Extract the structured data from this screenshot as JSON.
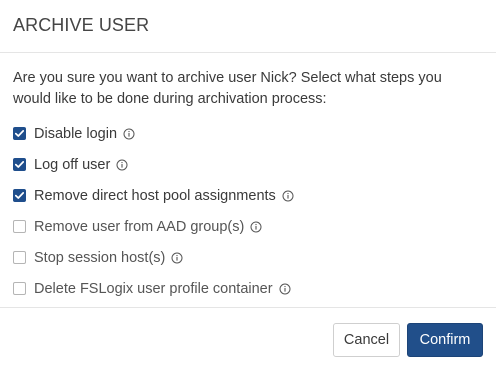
{
  "dialog": {
    "title": "ARCHIVE USER",
    "intro": "Are you sure you want to archive user Nick? Select what steps you would like to be done during archivation process:",
    "options": [
      {
        "label": "Disable login",
        "checked": true
      },
      {
        "label": "Log off user",
        "checked": true
      },
      {
        "label": "Remove direct host pool assignments",
        "checked": true
      },
      {
        "label": "Remove user from AAD group(s)",
        "checked": false
      },
      {
        "label": "Stop session host(s)",
        "checked": false
      },
      {
        "label": "Delete FSLogix user profile container",
        "checked": false
      }
    ],
    "buttons": {
      "cancel_label": "Cancel",
      "confirm_label": "Confirm"
    }
  },
  "icons": {
    "checkbox": "checkmark-icon",
    "info": "info-circle-icon"
  },
  "colors": {
    "accent": "#214f8a",
    "checkbox_checked": "#1f4e8c",
    "checkbox_border": "#b5b5b5",
    "divider": "#e5e5e5",
    "text": "#3a3a3a"
  }
}
